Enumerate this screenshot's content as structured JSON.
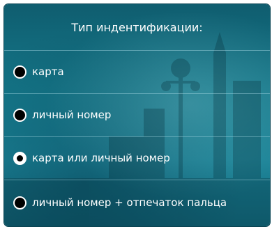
{
  "panel": {
    "title": "Тип индентификации:",
    "options": [
      {
        "label": "карта",
        "selected": false
      },
      {
        "label": "личный номер",
        "selected": false
      },
      {
        "label": "карта или личный номер",
        "selected": true
      },
      {
        "label": "личный номер + отпечаток пальца",
        "selected": false
      }
    ]
  },
  "colors": {
    "panel_bg": "#15788a",
    "text": "#ffffff",
    "radio_fill": "#000000",
    "radio_border": "#ffffff"
  }
}
